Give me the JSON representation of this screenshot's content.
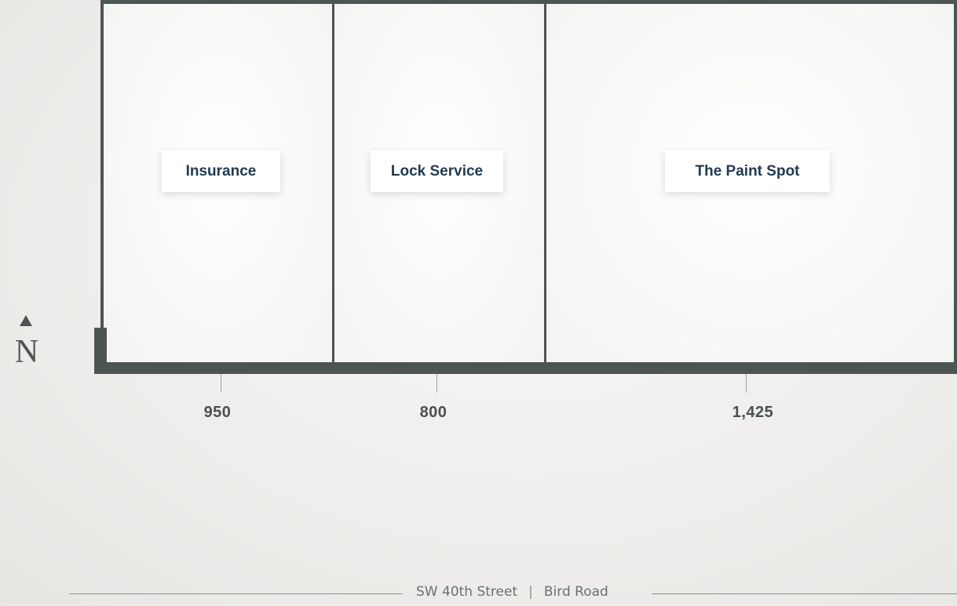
{
  "site_plan": {
    "units": [
      {
        "tenant": "Insurance",
        "sqft": "950"
      },
      {
        "tenant": "Lock Service",
        "sqft": "800"
      },
      {
        "tenant": "The Paint Spot",
        "sqft": "1,425"
      }
    ],
    "compass": {
      "letter": "N"
    },
    "street": {
      "name": "SW 40th Street",
      "separator": "|",
      "alt_name": "Bird Road"
    },
    "colors": {
      "walls": "#4d5454",
      "label_text": "#223a52",
      "background": "#efeeec"
    }
  }
}
